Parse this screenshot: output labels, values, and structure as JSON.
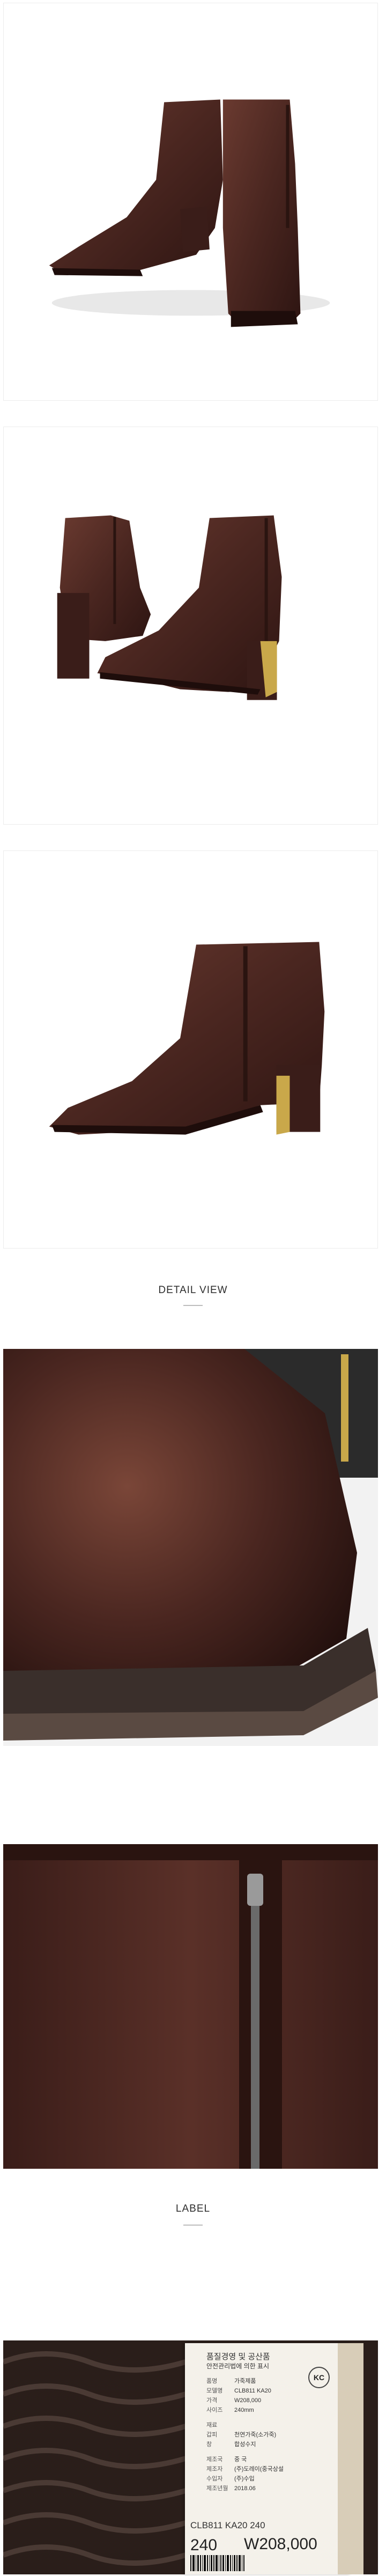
{
  "colors": {
    "leather": "#4a2620",
    "leather_dark": "#2e1512",
    "gold": "#c9a84a",
    "sole": "#3a2f2b"
  },
  "sections": {
    "detail_view_title": "DETAIL VIEW",
    "label_title": "LABEL"
  },
  "label": {
    "title": "품질경영 및 공산품",
    "subtitle": "안전관리법에 의한 표시",
    "cert_mark": "KC",
    "rows": [
      {
        "key": "품명",
        "value": "가죽제품"
      },
      {
        "key": "모델명",
        "value": "CLB811 KA20"
      },
      {
        "key": "가격",
        "value": "W208,000"
      },
      {
        "key": "사이즈",
        "value": "240mm"
      },
      {
        "key": "재료",
        "value": ""
      },
      {
        "key": "갑피",
        "value": "천연가죽(소가죽)"
      },
      {
        "key": "창",
        "value": "합성수지"
      },
      {
        "key": "제조국",
        "value": "중 국"
      },
      {
        "key": "제조자",
        "value": "(주)도레이(중국상설"
      },
      {
        "key": "수입자",
        "value": "(주)수입"
      },
      {
        "key": "제조년월",
        "value": "2018.06"
      }
    ],
    "footer_codes": "CLB811    KA20    240",
    "size_big": "240",
    "price_big": "W208,000"
  },
  "images": [
    {
      "name": "boots-pair-front-photo"
    },
    {
      "name": "boots-pair-side-photo"
    },
    {
      "name": "boot-single-side-photo"
    },
    {
      "name": "toe-detail-photo"
    },
    {
      "name": "zipper-detail-photo"
    },
    {
      "name": "label-sole-photo"
    }
  ]
}
